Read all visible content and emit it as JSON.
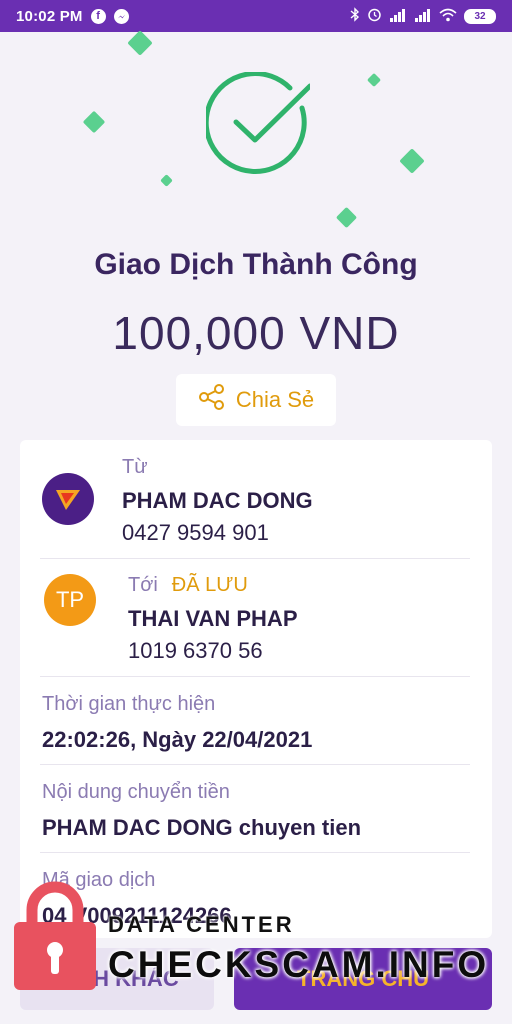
{
  "status_bar": {
    "time": "10:02 PM",
    "battery": "32",
    "icons": [
      "facebook-icon",
      "messenger-icon",
      "bluetooth-icon",
      "alarm-icon",
      "signal-icon",
      "signal-icon",
      "wifi-icon",
      "battery-icon"
    ]
  },
  "header": {
    "title": "Giao Dịch Thành Công",
    "amount": "100,000 VND",
    "check_color": "#2fb36b",
    "sparkle_color": "#5bd08f"
  },
  "share": {
    "label": "Chia Sẻ",
    "icon": "share-icon"
  },
  "from": {
    "label": "Từ",
    "name": "PHAM DAC DONG",
    "account": "0427 9594 901",
    "avatar_icon": "bank-logo-icon"
  },
  "to": {
    "label": "Tới",
    "saved_label": "ĐÃ LƯU",
    "initials": "TP",
    "name": "THAI VAN PHAP",
    "account": "1019 6370 56"
  },
  "details": {
    "time_label": "Thời gian thực hiện",
    "time_value": "22:02:26, Ngày 22/04/2021",
    "content_label": "Nội dung chuyển tiền",
    "content_value": "PHAM DAC DONG chuyen tien",
    "txid_label": "Mã giao dịch",
    "txid_value": "04 V009211124266"
  },
  "actions": {
    "other_label": "DỊCH KHÁC",
    "home_label": "TRANG CHỦ"
  },
  "watermark": {
    "small": "DATA CENTER",
    "big": "CHECKSCAM.INFO",
    "lock_color": "#e8525f"
  },
  "colors": {
    "brand_purple": "#6a2fb2",
    "accent_orange": "#e09b0c",
    "text_dark": "#2b1f47",
    "label_muted": "#8b7bb2"
  }
}
